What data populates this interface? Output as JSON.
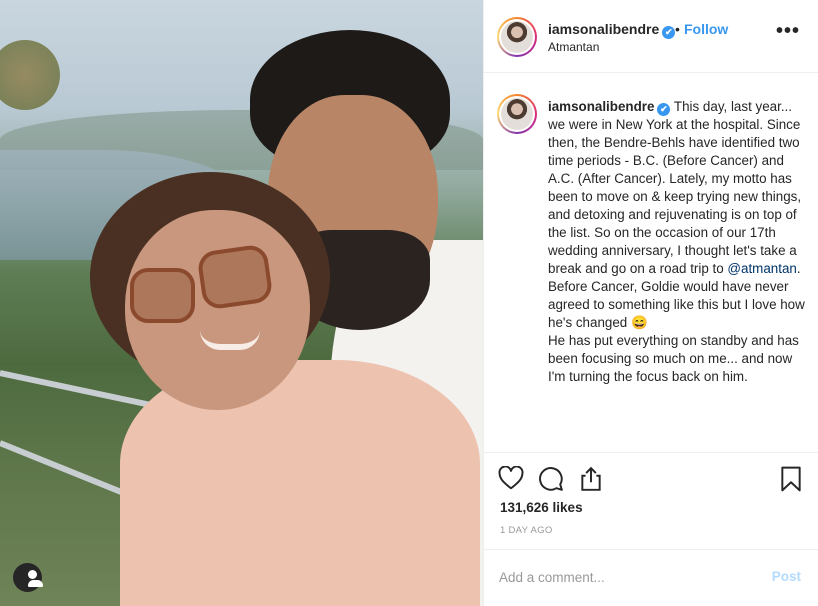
{
  "post": {
    "username": "iamsonalibendre",
    "verified_glyph": "✔",
    "separator": "•",
    "follow_label": "Follow",
    "location": "Atmantan",
    "more_glyph": "•••",
    "caption_before_mention": "This day, last year... we were in New York at the hospital. Since then, the Bendre-Behls have identified two time periods - B.C. (Before Cancer) and A.C. (After Cancer). Lately, my motto has been to move on & keep trying new things, and detoxing and rejuvenating is on top of the list. So on the occasion of our 17th wedding anniversary, I thought let's take a break and go on a road trip to ",
    "mention": "@atmantan",
    "caption_after_mention": ". Before Cancer, Goldie would have never agreed to something like this but I love how he's changed 😄",
    "caption_line2": "He has put everything on standby and has been focusing so much on me... and now I'm turning the focus back on him.",
    "likes": "131,626 likes",
    "timestamp": "1 DAY AGO"
  },
  "comment": {
    "placeholder": "Add a comment...",
    "post_label": "Post"
  },
  "icons": {
    "like": "heart-icon",
    "comment": "comment-bubble-icon",
    "share": "share-icon",
    "save": "bookmark-icon",
    "user": "user-icon"
  },
  "colors": {
    "link_blue": "#3897f0",
    "mention_blue": "#003569",
    "post_disabled": "#b3dbff"
  }
}
